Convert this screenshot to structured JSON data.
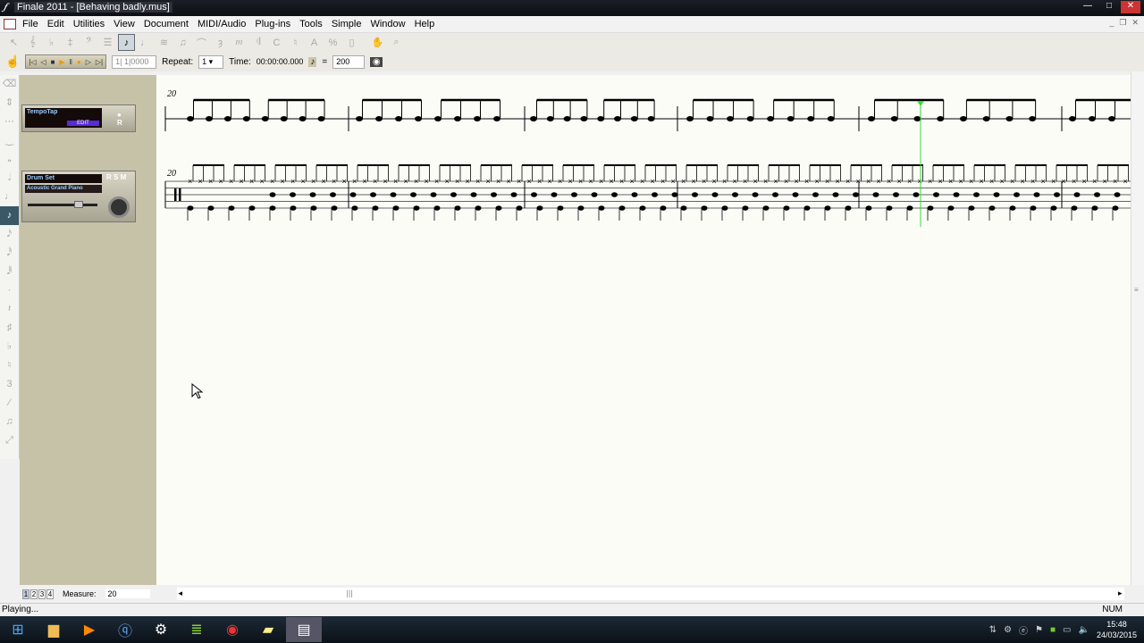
{
  "window": {
    "title": "Finale 2011 - [Behaving badly.mus]"
  },
  "menu": [
    "File",
    "Edit",
    "Utilities",
    "View",
    "Document",
    "MIDI/Audio",
    "Plug-ins",
    "Tools",
    "Simple",
    "Window",
    "Help"
  ],
  "playback": {
    "counter": "1| 1|0000",
    "repeat_label": "Repeat:",
    "repeat_value": "1",
    "time_label": "Time:",
    "time_value": "00:00:00.000",
    "equals": "=",
    "tempo": "200"
  },
  "mixer": {
    "tempotap_label": "TempoTap",
    "edit_label": "EDIT",
    "r_label": "R",
    "track_name": "Drum Set",
    "instrument": "Acoustic Grand Piano",
    "rsm": [
      "R",
      "S",
      "M"
    ]
  },
  "score": {
    "measure_number_top": "20",
    "measure_number_bottom": "20",
    "playhead_color": "#33dd33"
  },
  "bottom": {
    "pages": [
      "1",
      "2",
      "3",
      "4"
    ],
    "measure_label": "Measure:",
    "measure_value": "20"
  },
  "status": {
    "text": "Playing...",
    "num": "NUM"
  },
  "taskbar": {
    "time": "15:48",
    "date": "24/03/2015"
  }
}
